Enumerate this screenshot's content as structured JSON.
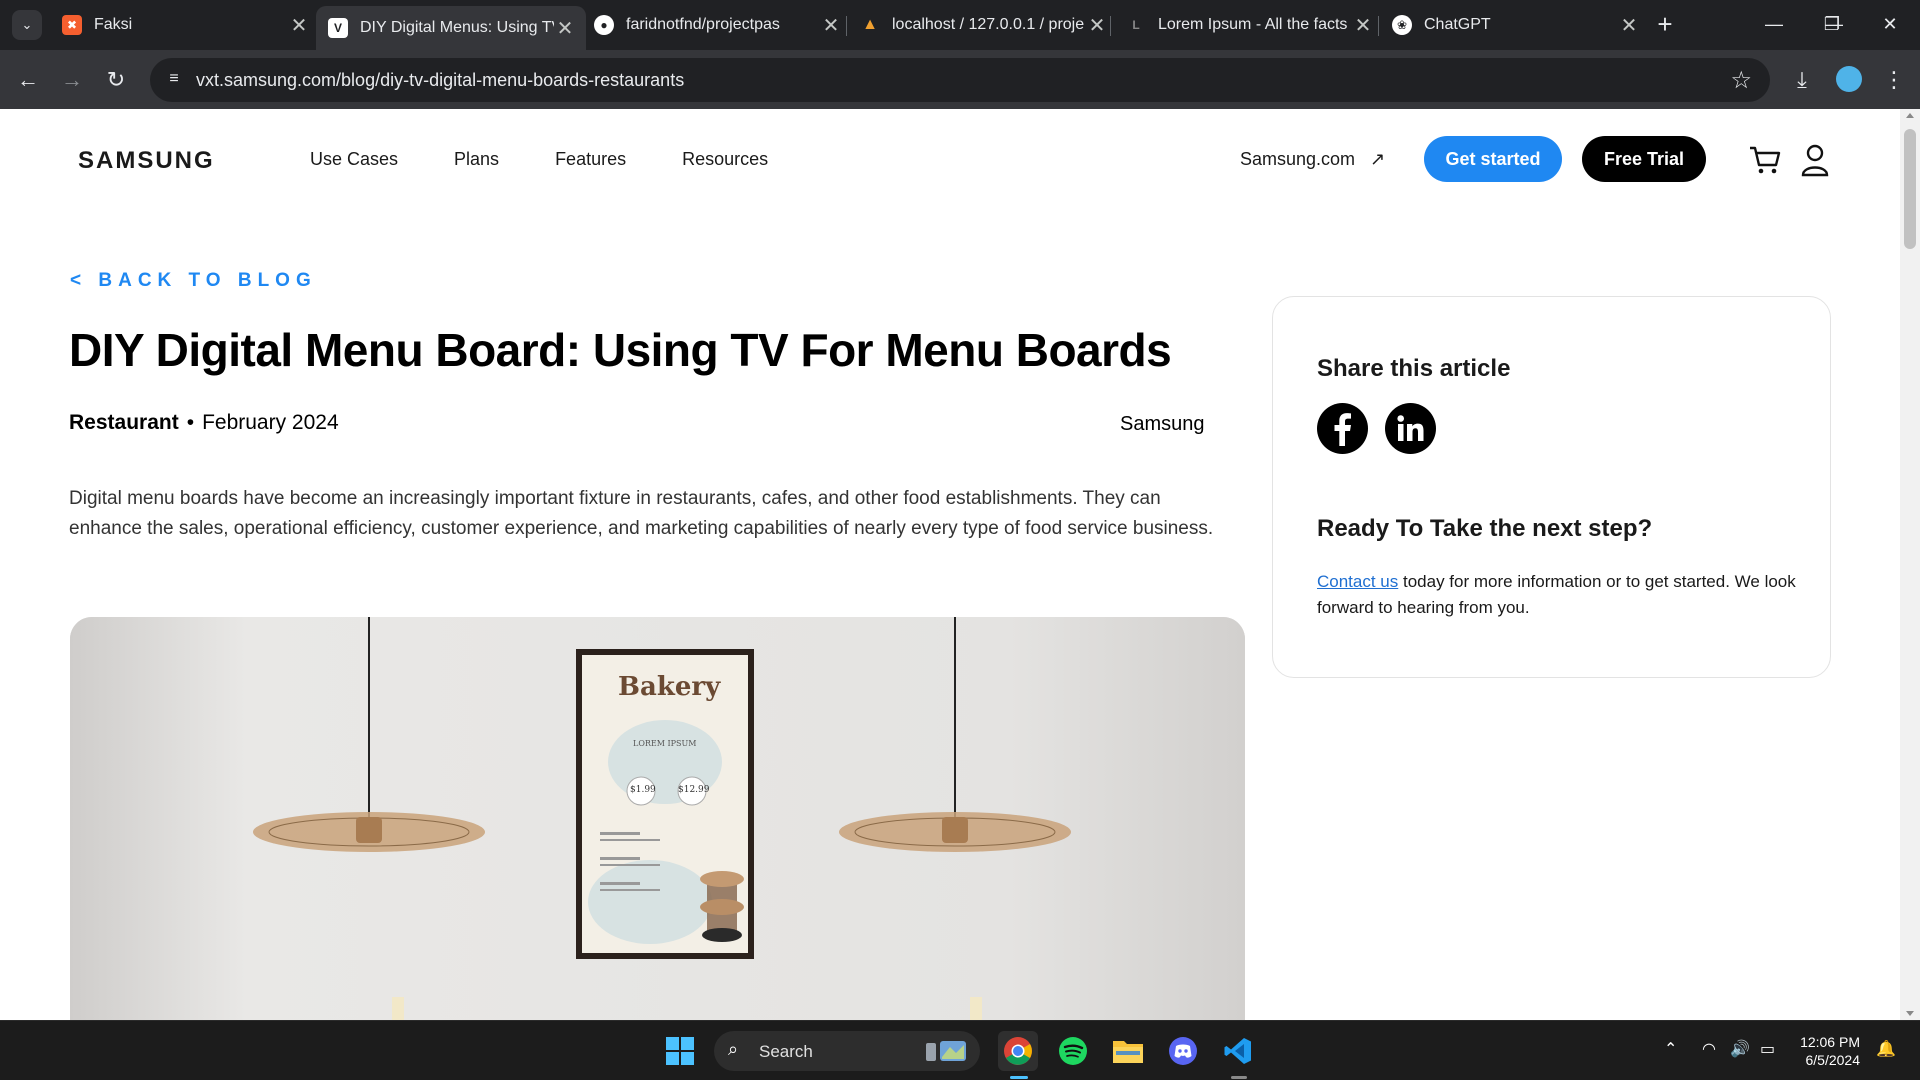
{
  "browser": {
    "tabs": [
      {
        "title": "Faksi",
        "icon": "xampp-icon",
        "color": "#f55f2f"
      },
      {
        "title": "DIY Digital Menus: Using TV",
        "icon": "v-icon",
        "color": "#ffffff"
      },
      {
        "title": "faridnotfnd/projectpas",
        "icon": "github-icon",
        "color": "#ffffff"
      },
      {
        "title": "localhost / 127.0.0.1 / proje",
        "icon": "phpmyadmin-icon",
        "color": "#f0a030"
      },
      {
        "title": "Lorem Ipsum - All the facts",
        "icon": "lorem-icon",
        "color": "#888888"
      },
      {
        "title": "ChatGPT",
        "icon": "chatgpt-icon",
        "color": "#ffffff"
      }
    ],
    "url": "vxt.samsung.com/blog/diy-tv-digital-menu-boards-restaurants"
  },
  "site": {
    "logo": "SAMSUNG",
    "nav": [
      "Use Cases",
      "Plans",
      "Features",
      "Resources"
    ],
    "samsung_link": "Samsung.com",
    "get_started": "Get started",
    "free_trial": "Free Trial",
    "accent": "#1f88f2"
  },
  "article": {
    "back": "< BACK TO BLOG",
    "title": "DIY Digital Menu Board: Using TV For Menu Boards",
    "category": "Restaurant",
    "date": "February 2024",
    "author": "Samsung",
    "intro": "Digital menu boards have become an increasingly important fixture in restaurants, cafes, and other food establishments. They can enhance the sales, operational efficiency, customer experience, and marketing capabilities of nearly every type of food service business."
  },
  "hero": {
    "sign_title": "Bakery",
    "sign_heading": "LOREM IPSUM",
    "price_1": "$1.99",
    "price_2": "$12.99"
  },
  "sidebar": {
    "share_heading": "Share this article",
    "next_heading": "Ready To Take the next step?",
    "contact_link": "Contact us",
    "contact_text": " today for more information or to get started. We look forward to hearing from you."
  },
  "taskbar": {
    "search": "Search",
    "time": "12:06 PM",
    "date": "6/5/2024"
  }
}
